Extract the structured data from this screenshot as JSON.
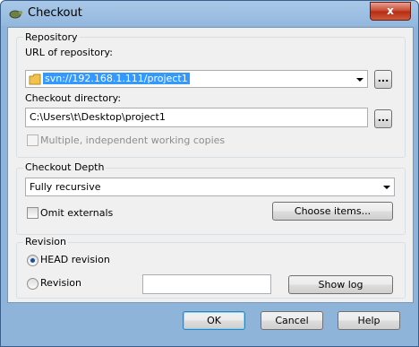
{
  "window": {
    "title": "Checkout",
    "close_label": "x"
  },
  "repository": {
    "group_label": "Repository",
    "url_label": "URL of repository:",
    "url_value": "svn://192.168.1.111/project1",
    "browse_label": "...",
    "dir_label": "Checkout directory:",
    "dir_value": "C:\\Users\\t\\Desktop\\project1",
    "dir_browse_label": "...",
    "multiple_label": "Multiple, independent working copies"
  },
  "depth": {
    "group_label": "Checkout Depth",
    "selected": "Fully recursive",
    "omit_label": "Omit externals",
    "choose_label": "Choose items..."
  },
  "revision": {
    "group_label": "Revision",
    "head_label": "HEAD revision",
    "revision_label": "Revision",
    "revision_value": "",
    "showlog_label": "Show log"
  },
  "footer": {
    "ok_label": "OK",
    "cancel_label": "Cancel",
    "help_label": "Help"
  }
}
